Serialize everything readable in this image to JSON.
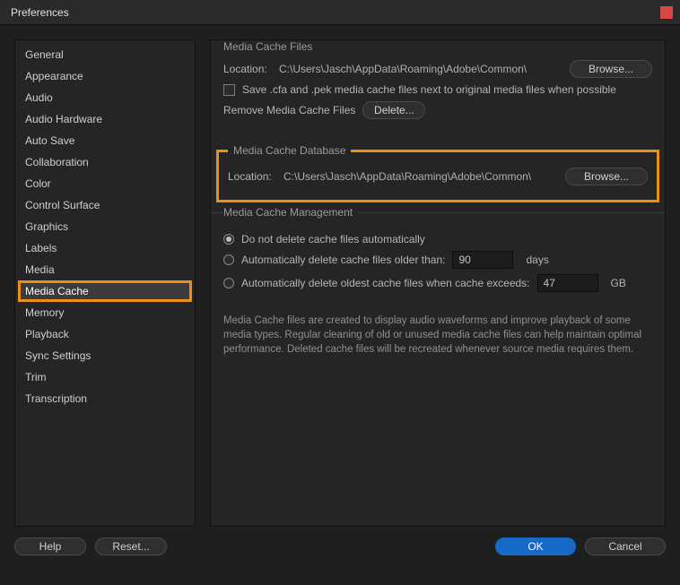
{
  "window": {
    "title": "Preferences"
  },
  "sidebar": {
    "items": [
      {
        "label": "General"
      },
      {
        "label": "Appearance"
      },
      {
        "label": "Audio"
      },
      {
        "label": "Audio Hardware"
      },
      {
        "label": "Auto Save"
      },
      {
        "label": "Collaboration"
      },
      {
        "label": "Color"
      },
      {
        "label": "Control Surface"
      },
      {
        "label": "Graphics"
      },
      {
        "label": "Labels"
      },
      {
        "label": "Media"
      },
      {
        "label": "Media Cache"
      },
      {
        "label": "Memory"
      },
      {
        "label": "Playback"
      },
      {
        "label": "Sync Settings"
      },
      {
        "label": "Trim"
      },
      {
        "label": "Transcription"
      }
    ],
    "selected_index": 11
  },
  "sections": {
    "files": {
      "legend": "Media Cache Files",
      "location_label": "Location:",
      "location_path": "C:\\Users\\Jasch\\AppData\\Roaming\\Adobe\\Common\\",
      "browse_label": "Browse...",
      "checkbox_label": "Save .cfa and .pek media cache files next to original media files when possible",
      "checkbox_checked": false,
      "remove_label": "Remove Media Cache Files",
      "delete_label": "Delete..."
    },
    "database": {
      "legend": "Media Cache Database",
      "location_label": "Location:",
      "location_path": "C:\\Users\\Jasch\\AppData\\Roaming\\Adobe\\Common\\",
      "browse_label": "Browse..."
    },
    "management": {
      "legend": "Media Cache Management",
      "radio1_label": "Do not delete cache files automatically",
      "radio2_label": "Automatically delete cache files older than:",
      "radio2_value": "90",
      "radio2_unit": "days",
      "radio3_label": "Automatically delete oldest cache files when cache exceeds:",
      "radio3_value": "47",
      "radio3_unit": "GB",
      "selected": 0,
      "description": "Media Cache files are created to display audio waveforms and improve playback of some media types.  Regular cleaning of old or unused media cache files can help maintain optimal performance. Deleted cache files will be recreated whenever source media requires them."
    }
  },
  "footer": {
    "help_label": "Help",
    "reset_label": "Reset...",
    "ok_label": "OK",
    "cancel_label": "Cancel"
  }
}
